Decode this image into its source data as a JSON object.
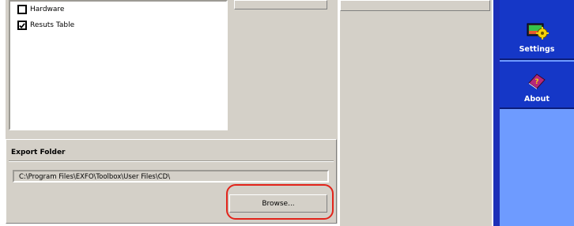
{
  "checklist": {
    "items": [
      {
        "label": "Hardware",
        "checked": false
      },
      {
        "label": "Resuts Table",
        "checked": true
      }
    ]
  },
  "export_folder": {
    "title": "Export Folder",
    "path": "C:\\Program Files\\EXFO\\Toolbox\\User Files\\CD\\",
    "browse_label": "Browse..."
  },
  "sidebar": {
    "settings_label": "Settings",
    "about_label": "About"
  },
  "colors": {
    "highlight": "#e2231a",
    "sidebar_button": "#1537c7",
    "sidebar_background": "#6e9bff"
  },
  "icons": {
    "settings": "settings-gear-icon",
    "about": "about-book-icon"
  }
}
